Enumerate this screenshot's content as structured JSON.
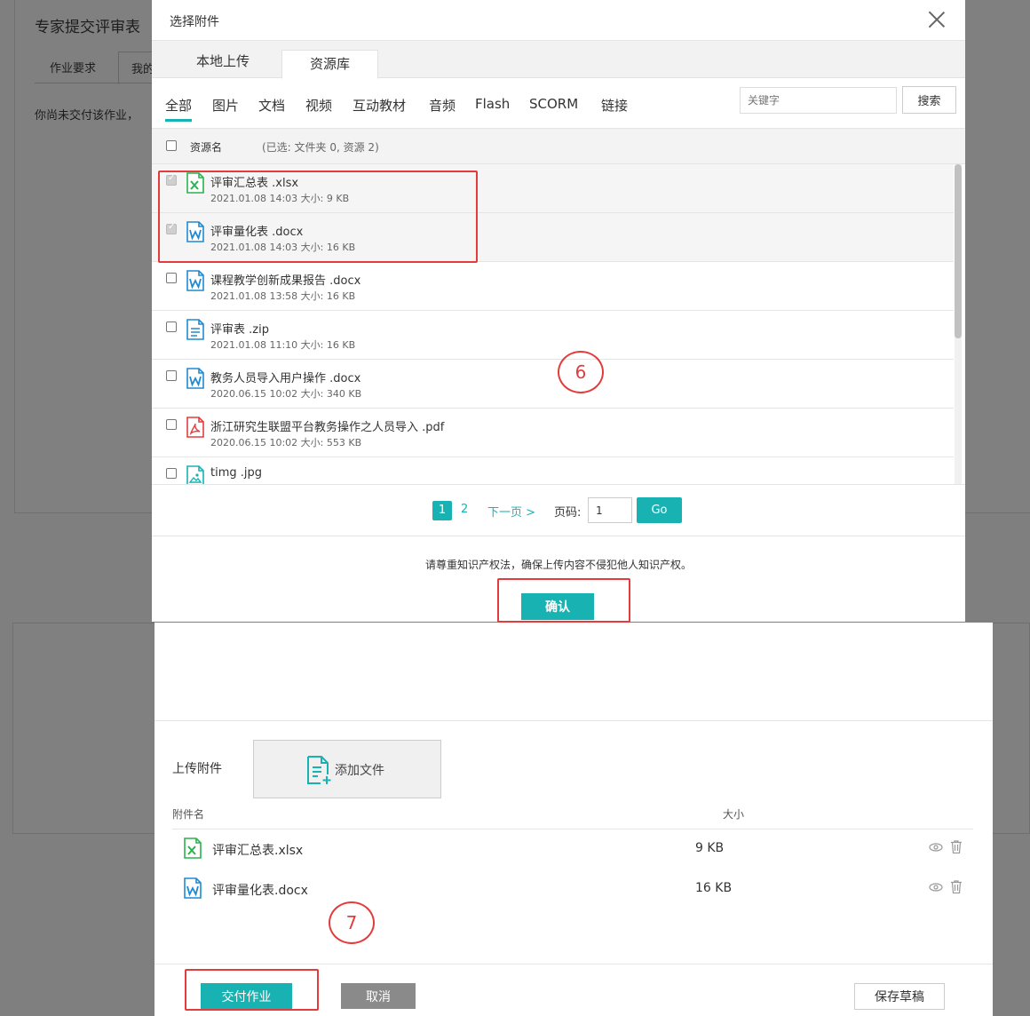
{
  "background": {
    "page_title": "专家提交评审表",
    "tabs": [
      "作业要求",
      "我的"
    ],
    "message": "你尚未交付该作业，"
  },
  "dialog": {
    "title": "选择附件",
    "upload_tabs": [
      "本地上传",
      "资源库"
    ],
    "active_upload_tab": "资源库",
    "filter_types": [
      "全部",
      "图片",
      "文档",
      "视频",
      "互动教材",
      "音频",
      "Flash",
      "SCORM",
      "链接"
    ],
    "active_filter": "全部",
    "keyword_placeholder": "关键字",
    "search_label": "搜索",
    "list_header": {
      "name": "资源名",
      "selected": "(已选: 文件夹 0, 资源 2)"
    },
    "files": [
      {
        "name": "评审汇总表 .xlsx",
        "meta": "2021.01.08 14:03   大小:  9 KB",
        "icon": "excel-icon",
        "checked": true
      },
      {
        "name": "评审量化表 .docx",
        "meta": "2021.01.08 14:03   大小:  16 KB",
        "icon": "word-icon",
        "checked": true
      },
      {
        "name": "课程教学创新成果报告 .docx",
        "meta": "2021.01.08 13:58   大小:  16 KB",
        "icon": "word-icon",
        "checked": false
      },
      {
        "name": "评审表 .zip",
        "meta": "2021.01.08 11:10   大小:  16 KB",
        "icon": "document-icon",
        "checked": false
      },
      {
        "name": "教务人员导入用户操作 .docx",
        "meta": "2020.06.15 10:02   大小:  340 KB",
        "icon": "word-icon",
        "checked": false
      },
      {
        "name": "浙江研究生联盟平台教务操作之人员导入 .pdf",
        "meta": "2020.06.15 10:02   大小:  553 KB",
        "icon": "pdf-icon",
        "checked": false
      },
      {
        "name": "timg .jpg",
        "meta": "",
        "icon": "image-icon",
        "checked": false
      }
    ],
    "pagination": {
      "current": "1",
      "page2": "2",
      "next": "下一页 >",
      "page_label": "页码:",
      "page_input": "1",
      "go": "Go"
    },
    "notice": "请尊重知识产权法，确保上传内容不侵犯他人知识产权。",
    "confirm": "确认"
  },
  "form": {
    "upload_label": "上传附件",
    "add_file": "添加文件",
    "col_name": "附件名",
    "col_size": "大小",
    "attachments": [
      {
        "name": "评审汇总表.xlsx",
        "size": "9 KB",
        "icon": "excel-icon"
      },
      {
        "name": "评审量化表.docx",
        "size": "16 KB",
        "icon": "word-icon"
      }
    ],
    "submit": "交付作业",
    "cancel": "取消",
    "save_draft": "保存草稿"
  },
  "annotations": {
    "step6": "6",
    "step7": "7"
  },
  "colors": {
    "accent": "#18b2b2",
    "annotation": "#e23c3c",
    "excel": "#2bb24c",
    "word": "#1f8ad1",
    "pdf": "#e33d3d"
  }
}
